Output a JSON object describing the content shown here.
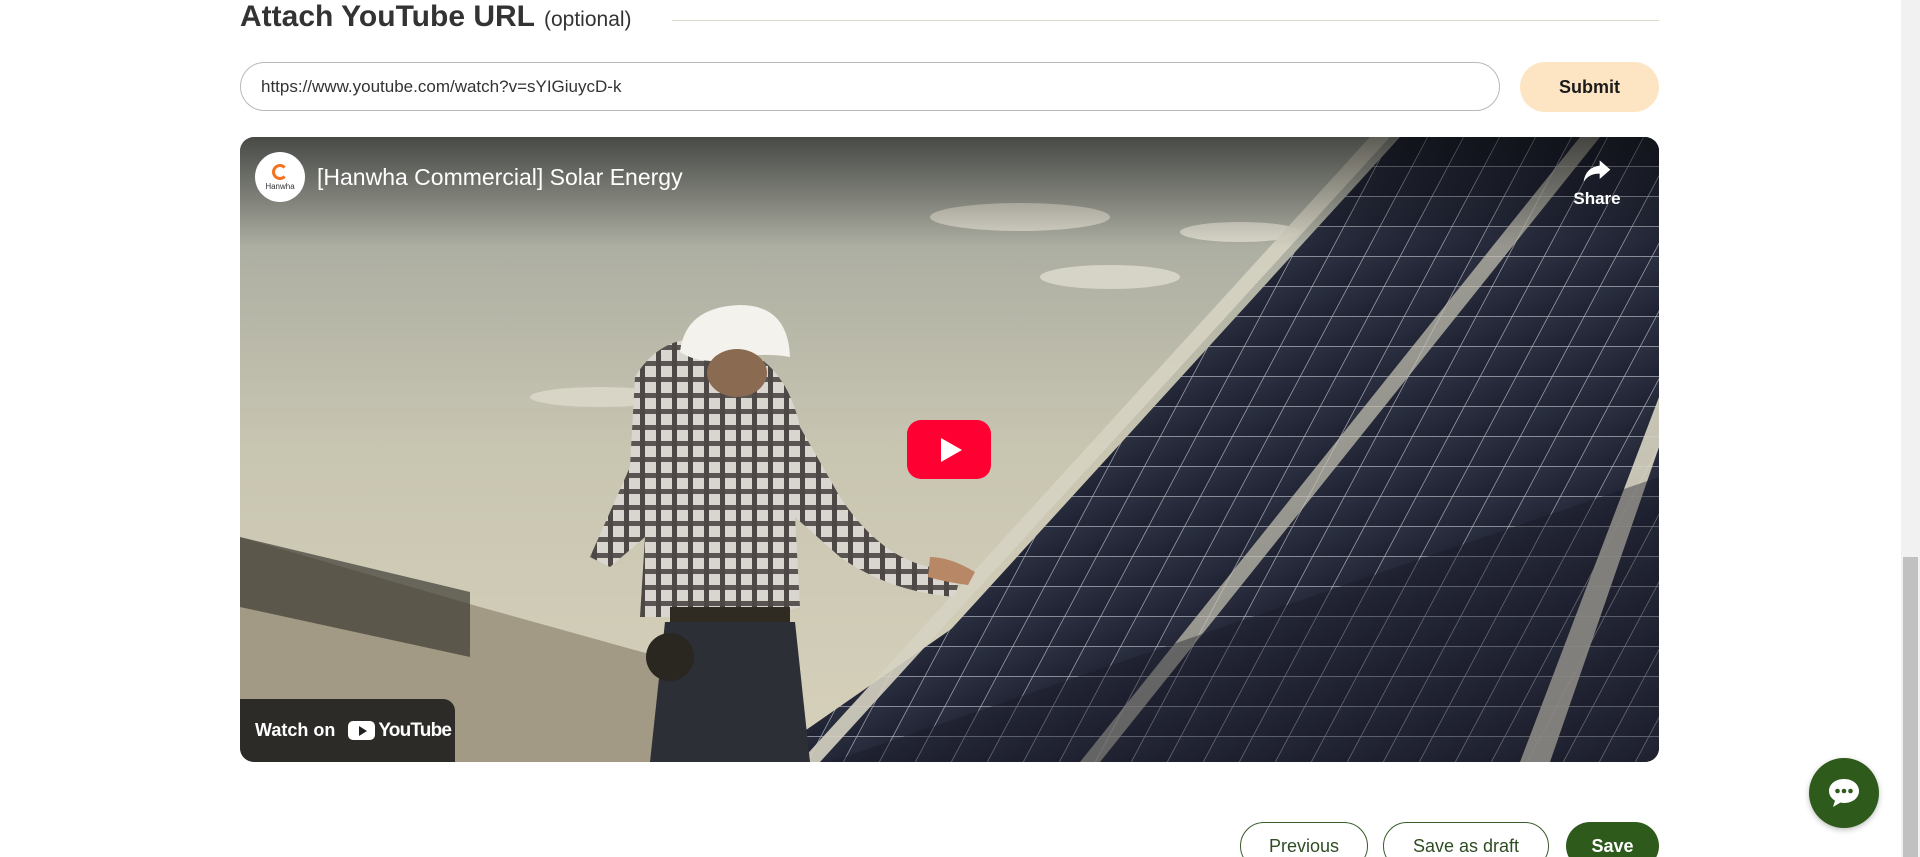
{
  "section": {
    "title": "Attach YouTube URL",
    "optional": "(optional)"
  },
  "url_field": {
    "value": "https://www.youtube.com/watch?v=sYIGiuycD-k"
  },
  "submit_label": "Submit",
  "video": {
    "title": "[Hanwha Commercial] Solar Energy",
    "channel_brand": "Hanwha",
    "share_label": "Share",
    "watch_on_label": "Watch on",
    "youtube_wordmark": "YouTube",
    "colors": {
      "play_button": "#ff0033"
    }
  },
  "footer": {
    "previous_label": "Previous",
    "draft_label": "Save as draft",
    "save_label": "Save"
  },
  "theme": {
    "primary": "#2e5a1c",
    "submit_bg": "#fde5c3"
  },
  "icons": {
    "chat": "chat-bubble-icon",
    "share": "share-arrow-icon",
    "play": "play-icon"
  }
}
